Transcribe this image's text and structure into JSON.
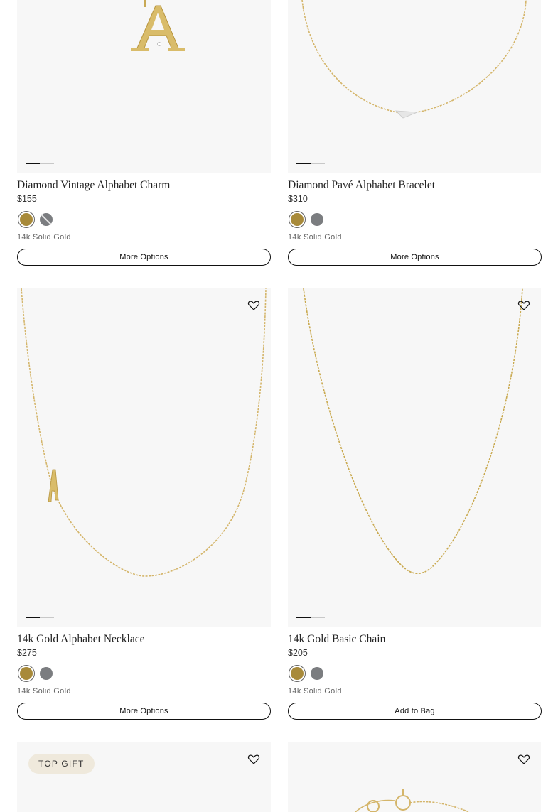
{
  "products": [
    {
      "title": "Diamond Vintage Alphabet Charm",
      "price": "$155",
      "metal": "14k Solid Gold",
      "button": "More Options",
      "swatches": [
        "gold",
        "white-gold-unavailable"
      ]
    },
    {
      "title": "Diamond Pavé Alphabet Bracelet",
      "price": "$310",
      "metal": "14k Solid Gold",
      "button": "More Options",
      "swatches": [
        "gold",
        "white-gold"
      ]
    },
    {
      "title": "14k Gold Alphabet Necklace",
      "price": "$275",
      "metal": "14k Solid Gold",
      "button": "More Options",
      "swatches": [
        "gold",
        "white-gold"
      ]
    },
    {
      "title": "14k Gold Basic Chain",
      "price": "$205",
      "metal": "14k Solid Gold",
      "button": "Add to Bag",
      "swatches": [
        "gold",
        "white-gold"
      ]
    },
    {
      "badge": "TOP GIFT"
    }
  ],
  "icons": {
    "wishlist": "heart-outline-icon"
  },
  "colors": {
    "gold_swatch": "#a88a3a",
    "white_gold_swatch": "#7b7d80",
    "image_bg": "#f7f7f7",
    "badge_bg": "#efe9dc"
  }
}
